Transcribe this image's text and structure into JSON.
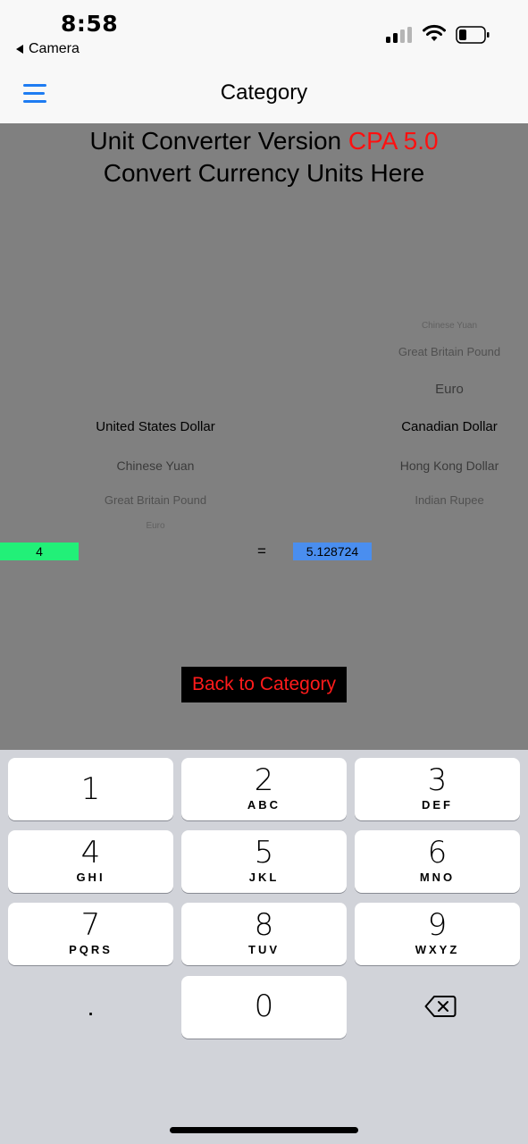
{
  "status_bar": {
    "time": "8:58",
    "back_app_label": "Camera",
    "icons": [
      "cellular-signal-icon",
      "wifi-icon",
      "battery-icon"
    ]
  },
  "nav": {
    "title": "Category",
    "menu_icon": "hamburger-menu-icon"
  },
  "heading": {
    "line1_prefix": "Unit Converter Version ",
    "line1_version": "CPA 5.0",
    "line2": "Convert Currency Units Here"
  },
  "converter": {
    "input_value": "4",
    "from_unit": "United States Dollar",
    "equals_sign": "=",
    "result_value": "5.128724",
    "to_unit": "Canadian Dollar",
    "from_picker_below": [
      "Chinese Yuan",
      "Great Britain Pound",
      "Euro"
    ],
    "to_picker_above": [
      "Chinese Yuan",
      "Great Britain Pound",
      "Euro"
    ],
    "to_picker_below": [
      "Hong Kong Dollar",
      "Indian Rupee"
    ]
  },
  "back_button_label": "Back to Category",
  "keyboard": {
    "keys": [
      {
        "digit": "1",
        "letters": ""
      },
      {
        "digit": "2",
        "letters": "ABC"
      },
      {
        "digit": "3",
        "letters": "DEF"
      },
      {
        "digit": "4",
        "letters": "GHI"
      },
      {
        "digit": "5",
        "letters": "JKL"
      },
      {
        "digit": "6",
        "letters": "MNO"
      },
      {
        "digit": "7",
        "letters": "PQRS"
      },
      {
        "digit": "8",
        "letters": "TUV"
      },
      {
        "digit": "9",
        "letters": "WXYZ"
      },
      {
        "digit": "0",
        "letters": ""
      }
    ],
    "decimal_label": ".",
    "delete_icon": "backspace-icon"
  },
  "colors": {
    "accent_red": "#ff1010",
    "input_green": "#22f078",
    "result_blue": "#4a8eef",
    "menu_blue": "#1e7cf2",
    "content_gray": "#808080"
  }
}
